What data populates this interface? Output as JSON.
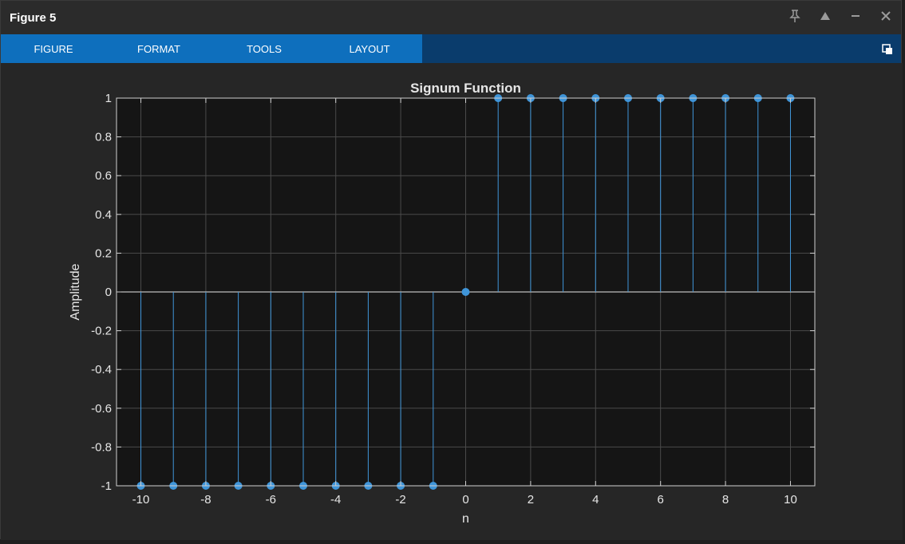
{
  "window": {
    "title": "Figure 5",
    "controls": [
      "pin-icon",
      "collapse-icon",
      "minimize-icon",
      "close-icon"
    ]
  },
  "toolstrip": {
    "tabs": [
      "FIGURE",
      "FORMAT",
      "TOOLS",
      "LAYOUT"
    ]
  },
  "colors": {
    "axes_bg": "#151515",
    "grid": "#4a4a4a",
    "stem": "#3f95d9",
    "text": "#e6e6e6"
  },
  "chart_data": {
    "type": "stem",
    "title": "Signum Function",
    "xlabel": "n",
    "ylabel": "Amplitude",
    "xlim": [
      -10.75,
      10.75
    ],
    "ylim": [
      -1,
      1
    ],
    "xticks": [
      -10,
      -8,
      -6,
      -4,
      -2,
      0,
      2,
      4,
      6,
      8,
      10
    ],
    "yticks": [
      1,
      0.8,
      0.6,
      0.4,
      0.2,
      0,
      -0.2,
      -0.4,
      -0.6,
      -0.8,
      -1
    ],
    "grid": true,
    "x": [
      -10,
      -9,
      -8,
      -7,
      -6,
      -5,
      -4,
      -3,
      -2,
      -1,
      0,
      1,
      2,
      3,
      4,
      5,
      6,
      7,
      8,
      9,
      10
    ],
    "y": [
      -1,
      -1,
      -1,
      -1,
      -1,
      -1,
      -1,
      -1,
      -1,
      -1,
      0,
      1,
      1,
      1,
      1,
      1,
      1,
      1,
      1,
      1,
      1
    ]
  }
}
